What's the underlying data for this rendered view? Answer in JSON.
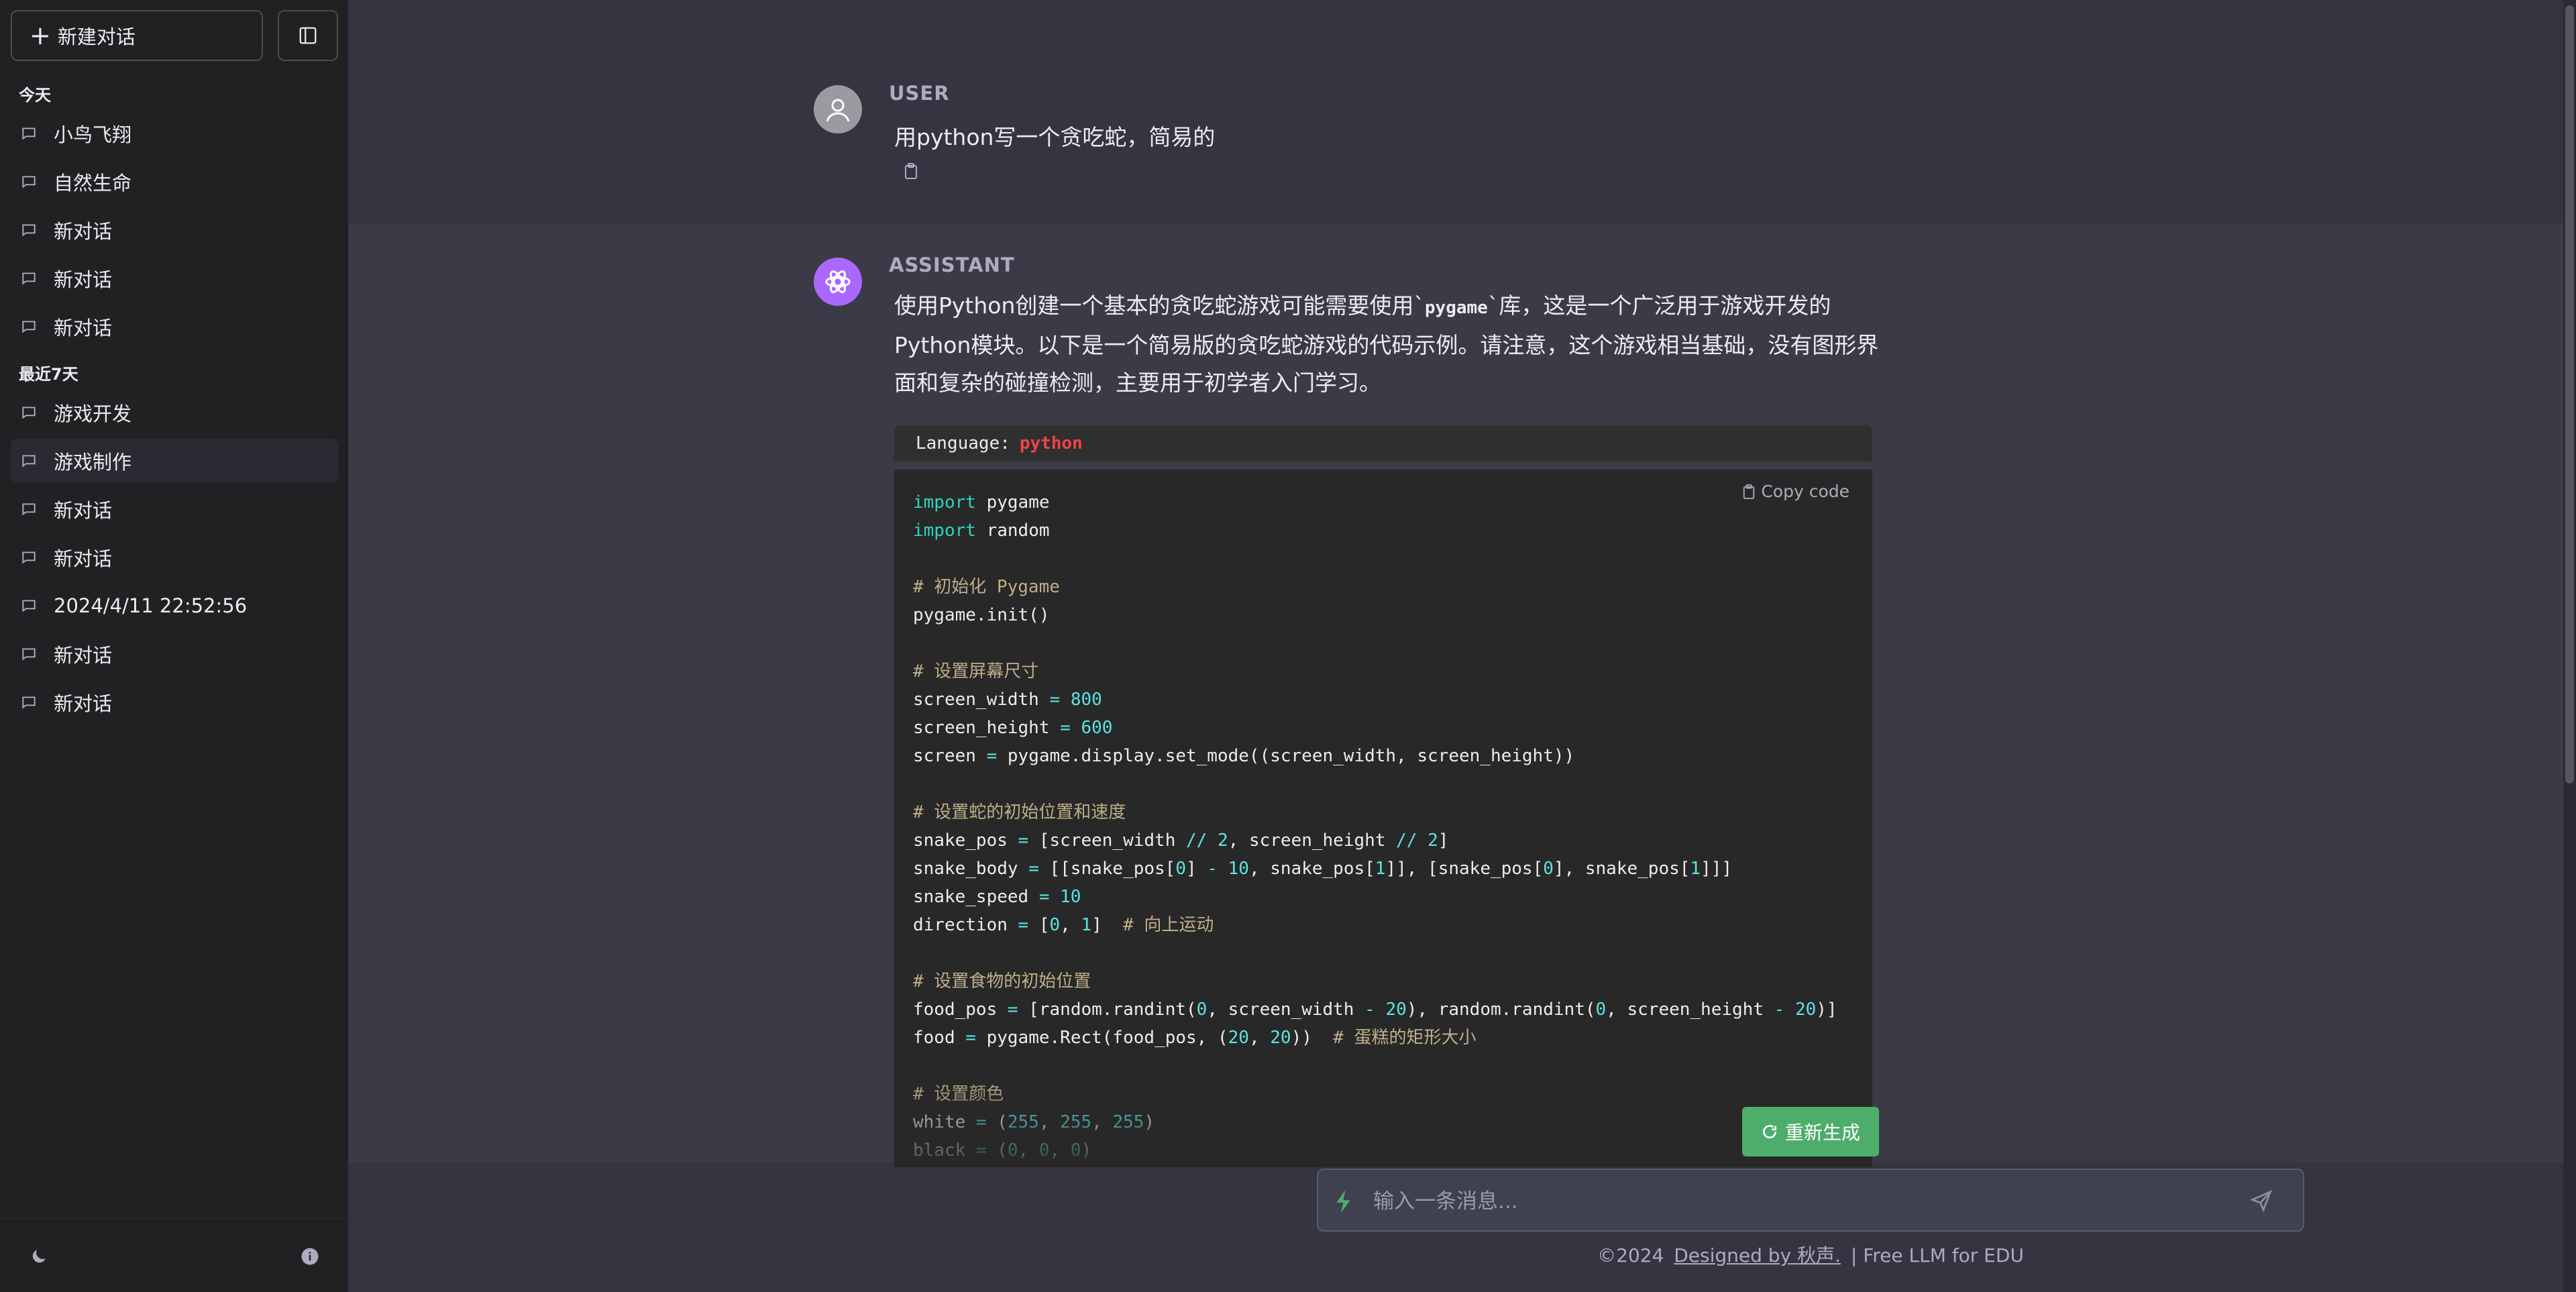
{
  "sidebar": {
    "new_chat_label": "新建对话",
    "sections": [
      {
        "title": "今天",
        "items": [
          "小鸟飞翔",
          "自然生命",
          "新对话",
          "新对话",
          "新对话"
        ]
      },
      {
        "title": "最近7天",
        "items": [
          "游戏开发",
          "游戏制作",
          "新对话",
          "新对话",
          "2024/4/11 22:52:56",
          "新对话",
          "新对话"
        ]
      }
    ],
    "active_item": "游戏制作"
  },
  "chat": {
    "user_role": "USER",
    "user_message": "用python写一个贪吃蛇，简易的",
    "assistant_role": "ASSISTANT",
    "assistant_intro_part1": "使用Python创建一个基本的贪吃蛇游戏可能需要使用`",
    "assistant_intro_code": "pygame",
    "assistant_intro_part2": "`库，这是一个广泛用于游戏开发的Python模块。以下是一个简易版的贪吃蛇游戏的代码示例。请注意，这个游戏相当基础，没有图形界面和复杂的碰撞检测，主要用于初学者入门学习。",
    "code_language_label": "Language:",
    "code_language": "python",
    "copy_code_label": "Copy code"
  },
  "actions": {
    "regenerate_label": "重新生成"
  },
  "input": {
    "placeholder": "输入一条消息..."
  },
  "footer": {
    "copyright": "©2024",
    "designer_link": "Designed by 秋声.",
    "tagline": "| Free LLM for EDU"
  },
  "colors": {
    "sidebar_bg": "#202123",
    "main_bg": "#343541",
    "accent_green": "#4ead6b",
    "assistant_avatar": "#ab68ff",
    "language_red": "#ef4444"
  }
}
